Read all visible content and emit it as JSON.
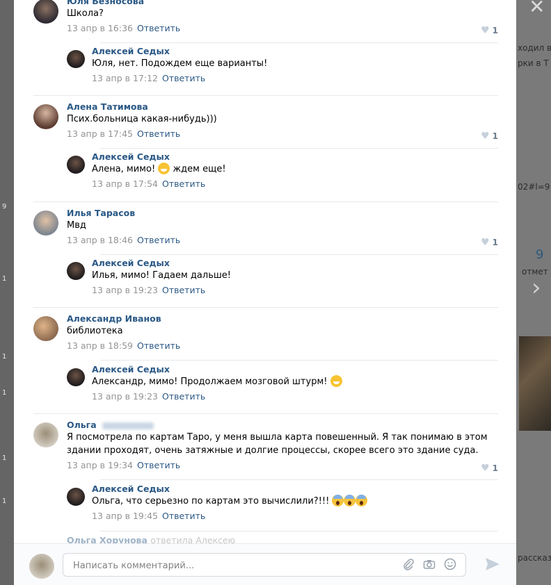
{
  "background": {
    "frag1": "ходил в",
    "frag2": "рки в Т",
    "frag3": "02#l=9",
    "count": "9",
    "count_label": "отмет",
    "frag4": "рассказ",
    "left_nums": [
      "9",
      "1",
      "1",
      "1",
      "1",
      "1"
    ]
  },
  "comments": [
    {
      "author": "Юля Безносова",
      "text": "Школа?",
      "date": "13 апр в 16:36",
      "reply": "Ответить",
      "likes": "1"
    },
    {
      "author": "Алексей Седых",
      "text": "Юля, нет. Подождем еще варианты!",
      "date": "13 апр в 17:12",
      "reply": "Ответить"
    },
    {
      "author": "Алена Татимова",
      "text": "Псих.больница какая-нибудь)))",
      "date": "13 апр в 17:45",
      "reply": "Ответить",
      "likes": "1"
    },
    {
      "author": "Алексей Седых",
      "text_before": "Алена, мимо!",
      "text_after": "ждем еще!",
      "date": "13 апр в 17:54",
      "reply": "Ответить"
    },
    {
      "author": "Илья Тарасов",
      "text": "Мвд",
      "date": "13 апр в 18:46",
      "reply": "Ответить",
      "likes": "1"
    },
    {
      "author": "Алексей Седых",
      "text": "Илья, мимо! Гадаем дальше!",
      "date": "13 апр в 19:23",
      "reply": "Ответить"
    },
    {
      "author": "Александр Иванов",
      "text": "библиотека",
      "date": "13 апр в 18:59",
      "reply": "Ответить"
    },
    {
      "author": "Алексей Седых",
      "text": "Александр, мимо! Продолжаем мозговой штурм!",
      "date": "13 апр в 19:23",
      "reply": "Ответить"
    },
    {
      "author": "Ольга",
      "text": "Я посмотрела по картам Таро, у меня вышла карта повешенный. Я так понимаю в этом здании проходят, очень затяжные и долгие процессы, скорее всего это здание суда.",
      "date": "13 апр в 19:34",
      "reply": "Ответить",
      "likes": "1"
    },
    {
      "author": "Алексей Седых",
      "text": "Ольга, что серьезно по картам это вычислили?!!!",
      "date": "13 апр в 19:45",
      "reply": "Ответить"
    }
  ],
  "partial": {
    "author": "Ольга Хорунова",
    "action": "ответила Алексею"
  },
  "composer": {
    "placeholder": "Написать комментарий..."
  }
}
